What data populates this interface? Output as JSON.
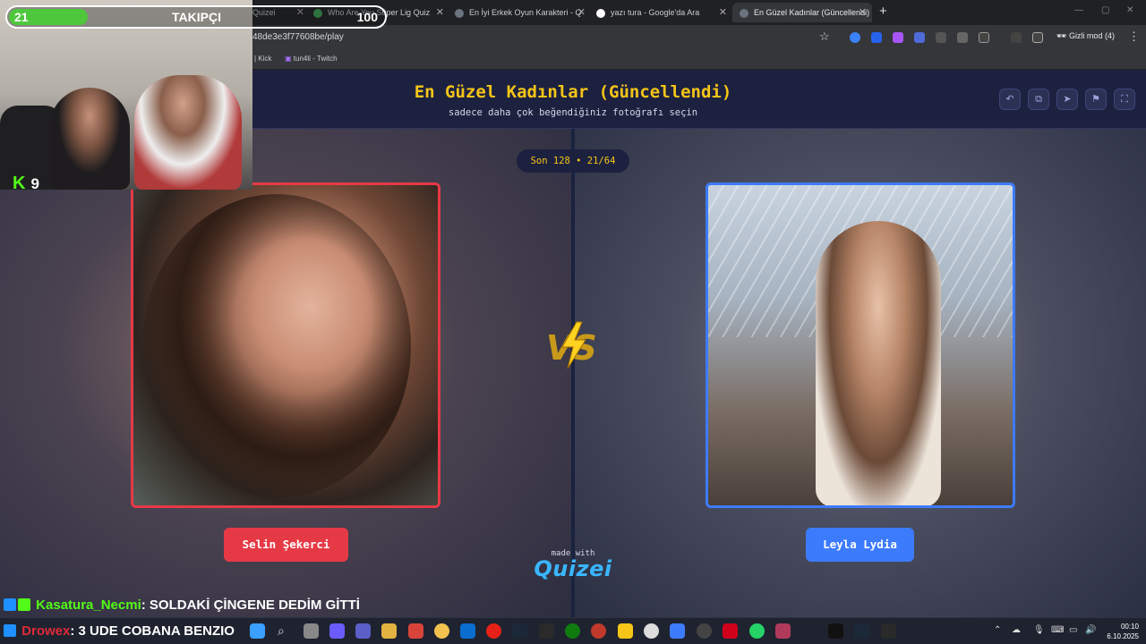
{
  "browser": {
    "tabs": [
      {
        "title": "Quizei"
      },
      {
        "title": "Who Are You Süper Lig Quiz"
      },
      {
        "title": "En İyi Erkek Oyun Karakteri - Q"
      },
      {
        "title": "yazı tura - Google'da Ara"
      },
      {
        "title": "En Güzel Kadınlar (Güncellendi)"
      }
    ],
    "new_tab": "+",
    "url": "48de3e3f77608be/play",
    "incognito_label": "Gizli mod (4)",
    "bookmarks": [
      "| Kick",
      "tun4li - Twitch"
    ]
  },
  "page": {
    "title": "En Güzel Kadınlar (Güncellendi)",
    "subtitle": "sadece daha çok beğendiğiniz fotoğrafı seçin",
    "round": "Son 128 • 21/64",
    "vs_label": "VS",
    "left": {
      "name": "Selin Şekerci",
      "border_color": "#e63946"
    },
    "right": {
      "name": "Leyla Lydia",
      "border_color": "#3d7bfd"
    },
    "made_with": "made with",
    "brand": "QUIZEI",
    "header_buttons": [
      "undo-icon",
      "share-icon",
      "send-icon",
      "flag-icon",
      "fullscreen-icon"
    ]
  },
  "stream": {
    "follower_current": "21",
    "follower_label": "TAKIPÇI",
    "follower_goal": "100",
    "follower_progress": 0.21,
    "kick_viewers": "9",
    "chat": [
      {
        "user": "Kasatura_Necmi",
        "message": ": SOLDAKİ ÇİNGENE DEDİM GİTTİ"
      },
      {
        "user": "Drowex",
        "message": ": 3 UDE COBANA BENZIO"
      }
    ]
  },
  "taskbar": {
    "time": "00:10",
    "date": "6.10.2025"
  },
  "colors": {
    "accent_yellow": "#f5c518",
    "left_red": "#e63946",
    "right_blue": "#3d7bfd",
    "kick_green": "#53fc18"
  }
}
